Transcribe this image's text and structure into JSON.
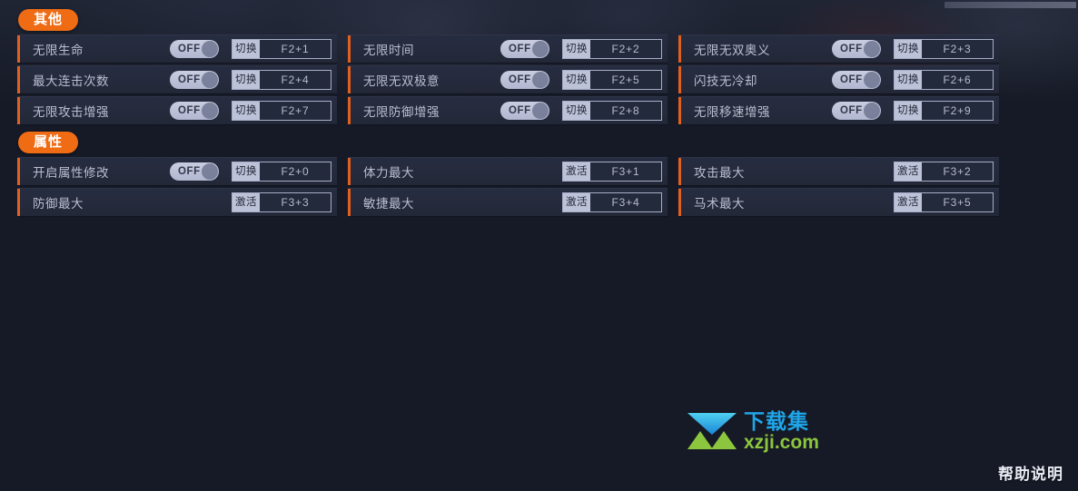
{
  "window": {
    "background_color": "#161a26",
    "accent_color": "#ef6c15",
    "help_label": "帮助说明"
  },
  "watermark": {
    "cn_text": "下载集",
    "en_text": "xzji.com",
    "cn_color": "#1fa5e8",
    "en_color": "#8cc63f"
  },
  "sections": [
    {
      "id": "other",
      "title": "其他",
      "rows": [
        [
          {
            "label": "无限生命",
            "toggle": true,
            "toggle_state": "OFF",
            "action": "切换",
            "hotkey": "F2+1"
          },
          {
            "label": "无限时间",
            "toggle": true,
            "toggle_state": "OFF",
            "action": "切换",
            "hotkey": "F2+2"
          },
          {
            "label": "无限无双奥义",
            "toggle": true,
            "toggle_state": "OFF",
            "action": "切换",
            "hotkey": "F2+3"
          }
        ],
        [
          {
            "label": "最大连击次数",
            "toggle": true,
            "toggle_state": "OFF",
            "action": "切换",
            "hotkey": "F2+4"
          },
          {
            "label": "无限无双极意",
            "toggle": true,
            "toggle_state": "OFF",
            "action": "切换",
            "hotkey": "F2+5"
          },
          {
            "label": "闪技无冷却",
            "toggle": true,
            "toggle_state": "OFF",
            "action": "切换",
            "hotkey": "F2+6"
          }
        ],
        [
          {
            "label": "无限攻击增强",
            "toggle": true,
            "toggle_state": "OFF",
            "action": "切换",
            "hotkey": "F2+7"
          },
          {
            "label": "无限防御增强",
            "toggle": true,
            "toggle_state": "OFF",
            "action": "切换",
            "hotkey": "F2+8"
          },
          {
            "label": "无限移速增强",
            "toggle": true,
            "toggle_state": "OFF",
            "action": "切换",
            "hotkey": "F2+9"
          }
        ]
      ]
    },
    {
      "id": "attr",
      "title": "属性",
      "rows": [
        [
          {
            "label": "开启属性修改",
            "toggle": true,
            "toggle_state": "OFF",
            "action": "切换",
            "hotkey": "F2+0"
          },
          {
            "label": "体力最大",
            "toggle": false,
            "toggle_state": "",
            "action": "激活",
            "hotkey": "F3+1"
          },
          {
            "label": "攻击最大",
            "toggle": false,
            "toggle_state": "",
            "action": "激活",
            "hotkey": "F3+2"
          }
        ],
        [
          {
            "label": "防御最大",
            "toggle": false,
            "toggle_state": "",
            "action": "激活",
            "hotkey": "F3+3"
          },
          {
            "label": "敏捷最大",
            "toggle": false,
            "toggle_state": "",
            "action": "激活",
            "hotkey": "F3+4"
          },
          {
            "label": "马术最大",
            "toggle": false,
            "toggle_state": "",
            "action": "激活",
            "hotkey": "F3+5"
          }
        ]
      ]
    }
  ]
}
